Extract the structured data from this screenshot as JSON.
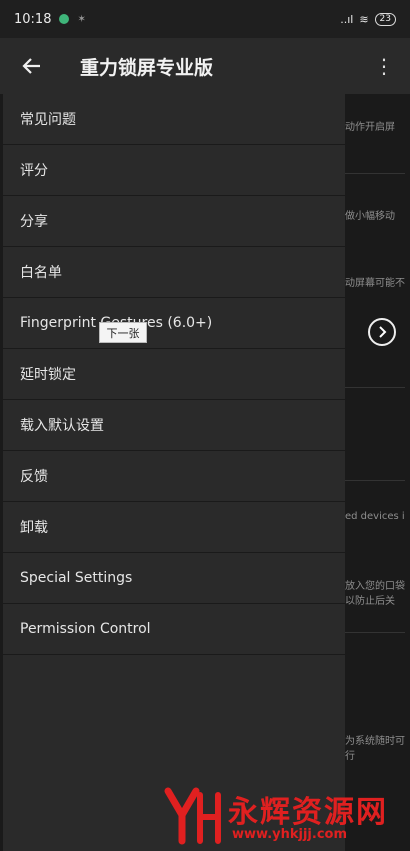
{
  "status_bar": {
    "time": "10:18",
    "signal": "..ıl",
    "battery": "23"
  },
  "app_bar": {
    "title": "重力锁屏专业版"
  },
  "drawer": {
    "items": [
      {
        "label": "常见问题"
      },
      {
        "label": "评分"
      },
      {
        "label": "分享"
      },
      {
        "label": "白名单"
      },
      {
        "label": "Fingerprint Gestures (6.0+)"
      },
      {
        "label": "延时锁定"
      },
      {
        "label": "载入默认设置"
      },
      {
        "label": "反馈"
      },
      {
        "label": "卸载"
      },
      {
        "label": "Special Settings"
      },
      {
        "label": "Permission Control"
      }
    ]
  },
  "tooltip": {
    "text": "下一张"
  },
  "background_hints": [
    {
      "text": "动作开启屏"
    },
    {
      "text": "做小幅移动"
    },
    {
      "text": "动屏幕可能不"
    },
    {
      "text": "ed devices it"
    },
    {
      "text": "放入您的口袋"
    },
    {
      "text": "以防止后关"
    },
    {
      "text": "为系统随时可"
    },
    {
      "text": "行"
    }
  ],
  "watermark": {
    "brand": "永辉资源网",
    "url": "www.yhkjjj.com"
  },
  "colors": {
    "accent": "#e02020",
    "drawer_bg": "#2a2a2a",
    "app_bar_bg": "#2a2a2a"
  }
}
